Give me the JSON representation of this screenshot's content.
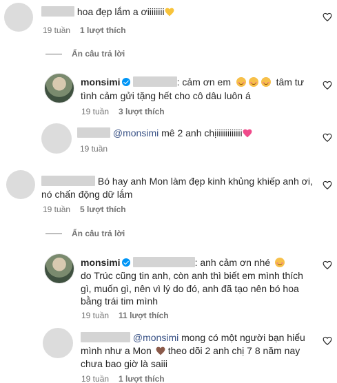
{
  "comments": [
    {
      "username_redacted": true,
      "text": "hoa đẹp lắm a ơiiiiiiii",
      "emoji": "yellow-heart",
      "time": "19 tuần",
      "likes": "1 lượt thích"
    },
    {
      "hide_replies": "Ẩn câu trả lời"
    },
    {
      "username": "monsimi",
      "text_line1": ": cảm ơn em",
      "text_line1_tail": "tâm tư",
      "text_line2": "tình cảm gửi tặng hết cho cô dâu luôn á",
      "time": "19 tuần",
      "likes": "3 lượt thích"
    },
    {
      "username_redacted": true,
      "mention": "@monsimi",
      "text": "mê 2 anh chịiiiiiiiiiiii",
      "emoji": "pink-heart",
      "time": "19 tuần"
    },
    {
      "username_redacted": true,
      "text_line1": "Bó hay anh Mon làm đẹp kinh khủng khiếp anh ơi,",
      "text_line2": "nó chấn động dữ lắm",
      "time": "19 tuần",
      "likes": "5 lượt thích"
    },
    {
      "hide_replies": "Ẩn câu trả lời"
    },
    {
      "username": "monsimi",
      "text_line1": ": anh cảm ơn nhé",
      "text_line2": "do Trúc cũng tin anh, còn anh thì biết em mình thích",
      "text_line3": "gì, muốn gì, nên vì lý do đó, anh đã tạo nên bó hoa",
      "text_line4": "bằng trái tim mình",
      "time": "19 tuần",
      "likes": "11 lượt thích"
    },
    {
      "username_redacted": true,
      "mention": "@monsimi",
      "text_line1": "mong có một người bạn hiểu",
      "text_line2_a": "mình như a Mon",
      "text_line2_b": "theo dõi 2 anh chị 7 8 năm nay",
      "text_line3": "chưa bao giờ là saiii",
      "time": "19 tuần",
      "likes": "1 lượt thích"
    }
  ],
  "colors": {
    "text": "#262626",
    "meta": "#737373",
    "mention": "#385185",
    "verified": "#0095f6"
  }
}
